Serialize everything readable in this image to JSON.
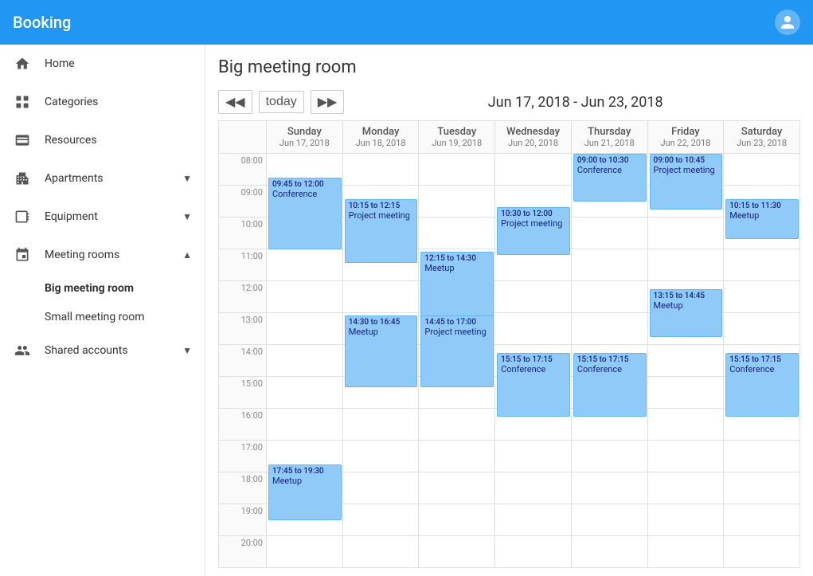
{
  "app": {
    "title": "Booking",
    "user_icon": "person-icon"
  },
  "sidebar": {
    "nav_items": [
      {
        "id": "home",
        "label": "Home",
        "icon": "home-icon"
      },
      {
        "id": "categories",
        "label": "Categories",
        "icon": "grid-icon"
      },
      {
        "id": "resources",
        "label": "Resources",
        "icon": "resources-icon"
      }
    ],
    "sections": [
      {
        "id": "apartments",
        "label": "Apartments",
        "expanded": false,
        "items": []
      },
      {
        "id": "equipment",
        "label": "Equipment",
        "expanded": false,
        "items": []
      },
      {
        "id": "meeting-rooms",
        "label": "Meeting rooms",
        "expanded": true,
        "items": [
          {
            "id": "big-meeting-room",
            "label": "Big meeting room",
            "active": true
          },
          {
            "id": "small-meeting-room",
            "label": "Small meeting room",
            "active": false
          }
        ]
      },
      {
        "id": "shared-accounts",
        "label": "Shared accounts",
        "expanded": false,
        "items": []
      }
    ]
  },
  "main": {
    "page_title": "Big meeting room",
    "nav": {
      "prev_label": "◀◀",
      "today_label": "today",
      "next_label": "▶▶",
      "date_range": "Jun 17, 2018 - Jun 23, 2018"
    },
    "calendar": {
      "days": [
        {
          "name": "Sunday",
          "date": "Jun 17, 2018"
        },
        {
          "name": "Monday",
          "date": "Jun 18, 2018"
        },
        {
          "name": "Tuesday",
          "date": "Jun 19, 2018"
        },
        {
          "name": "Wednesday",
          "date": "Jun 20, 2018"
        },
        {
          "name": "Thursday",
          "date": "Jun 21, 2018"
        },
        {
          "name": "Friday",
          "date": "Jun 22, 2018"
        },
        {
          "name": "Saturday",
          "date": "Jun 23, 2018"
        }
      ],
      "times": [
        "08:00",
        "09:00",
        "10:00",
        "11:00",
        "12:00",
        "13:00",
        "14:00",
        "15:00",
        "16:00",
        "17:00",
        "18:00",
        "19:00",
        "20:00"
      ],
      "events": [
        {
          "day": 0,
          "title": "Conference",
          "time": "09:45 to 12:00",
          "start_pct": 45,
          "height_pct": 135
        },
        {
          "day": 0,
          "title": "Meetup",
          "time": "17:45 to 19:30",
          "start_pct": 585,
          "height_pct": 105
        },
        {
          "day": 1,
          "title": "Project meeting",
          "time": "10:15 to 12:15",
          "start_pct": 85,
          "height_pct": 120
        },
        {
          "day": 1,
          "title": "Meetup",
          "time": "14:30 to 16:45",
          "start_pct": 305,
          "height_pct": 135
        },
        {
          "day": 2,
          "title": "Meetup",
          "time": "12:15 to 14:30",
          "start_pct": 185,
          "height_pct": 135
        },
        {
          "day": 2,
          "title": "Project meeting",
          "time": "14:45 to 17:00",
          "start_pct": 305,
          "height_pct": 135
        },
        {
          "day": 3,
          "title": "Project meeting",
          "time": "10:30 to 12:00",
          "start_pct": 100,
          "height_pct": 90
        },
        {
          "day": 3,
          "title": "Conference",
          "time": "15:15 to 17:15",
          "start_pct": 375,
          "height_pct": 120
        },
        {
          "day": 4,
          "title": "Conference",
          "time": "09:00 to 10:30",
          "start_pct": 0,
          "height_pct": 90
        },
        {
          "day": 4,
          "title": "Conference",
          "time": "15:15 to 17:15",
          "start_pct": 375,
          "height_pct": 120
        },
        {
          "day": 5,
          "title": "Project meeting",
          "time": "09:00 to 10:45",
          "start_pct": 0,
          "height_pct": 105
        },
        {
          "day": 5,
          "title": "Meetup",
          "time": "13:15 to 14:45",
          "start_pct": 255,
          "height_pct": 90
        },
        {
          "day": 6,
          "title": "Meetup",
          "time": "10:15 to 11:30",
          "start_pct": 85,
          "height_pct": 75
        },
        {
          "day": 6,
          "title": "Conference",
          "time": "15:15 to 17:15",
          "start_pct": 375,
          "height_pct": 120
        }
      ]
    }
  }
}
